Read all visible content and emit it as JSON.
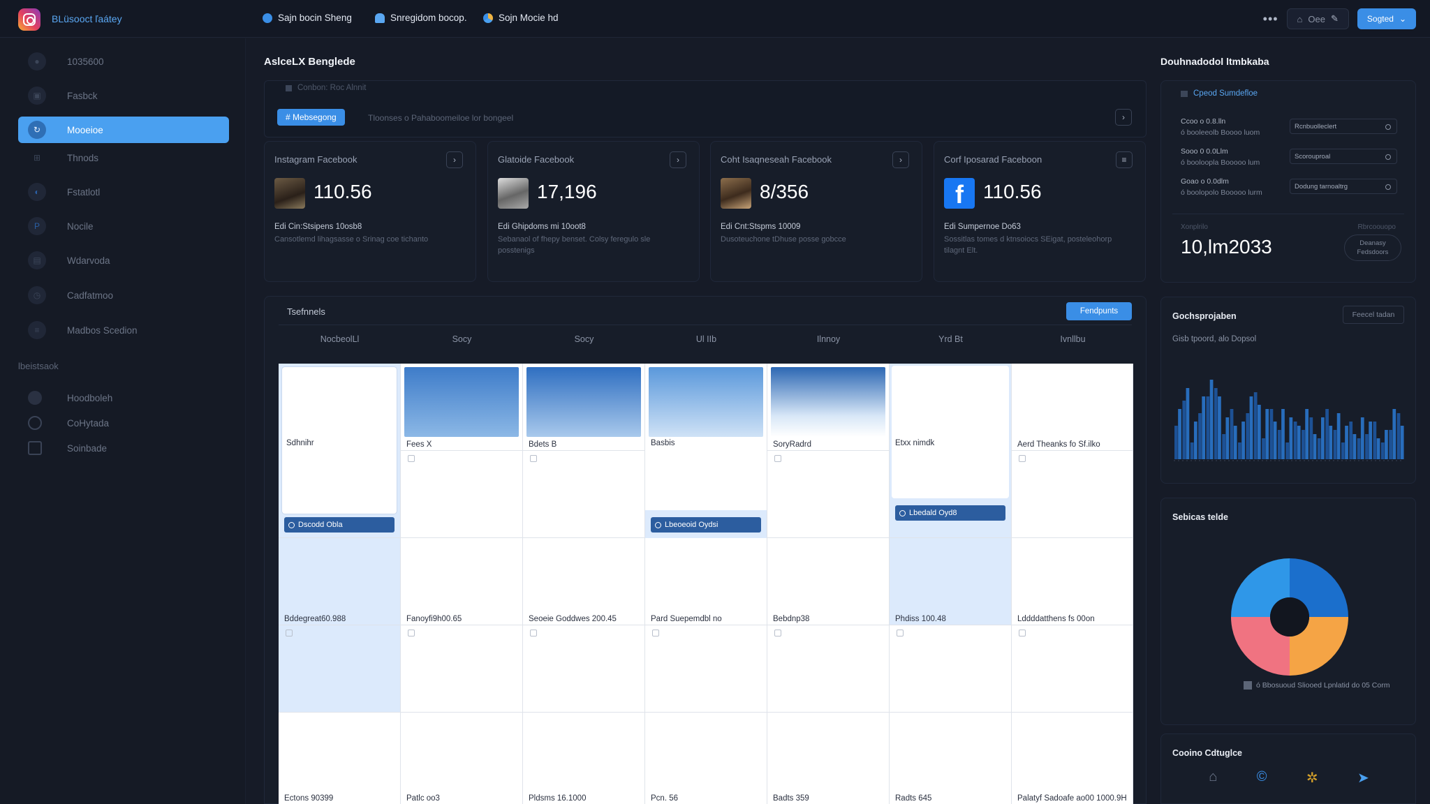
{
  "app": {
    "brand": "BLüsooct ľaátey"
  },
  "topnav": [
    {
      "label": "Sajn bocin Sheng",
      "color": "#3a8ee6"
    },
    {
      "label": "Snregidom bocop.",
      "color": "#5aa7f2"
    },
    {
      "label": "Sojn Mocie hd",
      "color": "#f0b443"
    }
  ],
  "topright": {
    "more": "•••",
    "ghost_label": "Oee",
    "primary_label": "Sogted"
  },
  "sidebar": {
    "items": [
      {
        "label": "1035600",
        "icon": "circle-icon"
      },
      {
        "label": "Fasbck",
        "icon": "image-icon"
      },
      {
        "label": "Mooeioe",
        "icon": "refresh-icon",
        "active": true
      },
      {
        "label": "Thnods",
        "icon": "grid-icon"
      },
      {
        "label": "Fstatlotl",
        "icon": "calendar-icon"
      },
      {
        "label": "Nocile",
        "icon": "page-icon"
      },
      {
        "label": "Wdarvoda",
        "icon": "lock-icon"
      },
      {
        "label": "Cadfatmoo",
        "icon": "clock-icon"
      },
      {
        "label": "Madbos Scedion",
        "icon": "sliders-icon"
      }
    ],
    "section_label": "lbeistsaok",
    "sub_items": [
      {
        "label": "Hoodboleh",
        "icon": "settings-icon"
      },
      {
        "label": "CoHytada",
        "icon": "circle-outline-icon"
      },
      {
        "label": "Soinbade",
        "icon": "calendar-outline-icon"
      }
    ]
  },
  "main": {
    "title": "AslceLX Benglede",
    "filter_hint": "Conbon: Roc Alnnit",
    "chip": "# Mebsegong",
    "filter_text": "Tloonses o Pahaboomeiloe lor bongeel",
    "cards": [
      {
        "title": "Instagram Facebook",
        "value": "110.56",
        "line1": "Edi Cin:Stsipens 10osb8",
        "line2": "Cansotlemd lihagsasse o Srinag coe tichanto",
        "thumb": "photo"
      },
      {
        "title": "Glatoide Facebook",
        "value": "17,196",
        "line1": "Edi Ghipdoms mi 10oot8",
        "line2": "Sebanaol of fhepy benset. Colsy feregulo sle posstenigs",
        "thumb": "photo"
      },
      {
        "title": "Coht Isaqneseah Facebook",
        "value": "8/356",
        "line1": "Edi Cnt:Stspms 10009",
        "line2": "Dusoteuchone tDhuse posse gobcce",
        "thumb": "photo"
      },
      {
        "title": "Corf Iposarad Faceboon",
        "value": "110.56",
        "line1": "Edi Sumpernoe Do63",
        "line2": "Sossitlas tomes d ktnsoiocs SEigat, posteleohorp tilagnt Elt.",
        "thumb": "facebook"
      }
    ]
  },
  "calendar": {
    "title": "Tsefnnels",
    "button": "Fendpunts",
    "days": [
      "NocbeolLl",
      "Socy",
      "Socy",
      "Ul IIb",
      "Ilnnoy",
      "Yrd Bt",
      "Ivnllbu"
    ],
    "rows": [
      [
        "Sdhnihr",
        "Fees X",
        "Bdets B",
        "Basbis",
        "SoryRadrd",
        "Etxx nimdk",
        "Aerd Theanks fo Sf.ilko"
      ],
      [
        "Bddegreat60.988",
        "Fanoyfi9h00.65",
        "Seoeie Goddwes 200.45",
        "Pard Suepemdbl no",
        "Bebdnp38",
        "Phdiss 100.48",
        "Lddddatthens fs 00on"
      ],
      [
        "Ectons 90399",
        "Patlc oo3",
        "Pldsms 16.1000",
        "Pcn. 56",
        "Badts 359",
        "Radts 645",
        "Palatyf Sadoafe ao00 1000.9H"
      ]
    ],
    "events": [
      "Dscodd Obla",
      "Lbeoeoid Oydsi",
      "Lbedald Oyd8"
    ]
  },
  "right": {
    "title": "Douhnadodol ltmbkaba",
    "panel_head": "Cpeod Sumdefloe",
    "rows": [
      {
        "a": "Ccoo o 0.8.lln",
        "b": "ó booleeolb Boooo luom",
        "select": "Rcnbuolleclert"
      },
      {
        "a": "Sooo 0 0.0Llm",
        "b": "ó booloopla Booooo lum",
        "select": "Scorouproal"
      },
      {
        "a": "Goao o 0.0dlm",
        "b": "ó boolopolo Booooo lurm",
        "select": "Dodung tarnoaltrg"
      }
    ],
    "left_small": "Xonplrilo",
    "right_small": "Rbrcoouopo",
    "big_value": "10,lm2033",
    "pill": "Deanasy Fedsdoors",
    "chart_card": {
      "title": "Gochsprojaben",
      "button": "Feecel tadan",
      "subtitle": "Gisb tpoord, alo Dopsol"
    },
    "pie_card": {
      "title": "Sebicas telde",
      "legend": "ó Bbosuoud Sliooed Lpnlatid do 05 Corm"
    },
    "icons_card": {
      "title": "Cooino Cdtuglce"
    }
  },
  "chart_data": [
    {
      "type": "bar",
      "title": "Gochsprojaben",
      "subtitle": "Gisb tpoord, alo Dopsol",
      "series": [
        {
          "values": [
            40,
            70,
            20,
            55,
            75,
            85,
            30,
            60,
            20,
            55,
            80,
            25,
            60,
            35,
            20,
            45,
            35,
            50,
            25,
            60,
            35,
            20,
            45,
            25,
            30,
            45,
            20,
            35,
            55
          ]
        },
        {
          "values": [
            60,
            85,
            45,
            75,
            95,
            75,
            50,
            40,
            45,
            75,
            65,
            60,
            45,
            60,
            50,
            40,
            60,
            30,
            50,
            40,
            55,
            40,
            30,
            50,
            45,
            25,
            35,
            60,
            40
          ]
        }
      ],
      "colors": [
        "#1f5aa8",
        "#2c7bd6"
      ]
    },
    {
      "type": "pie",
      "title": "Sebicas telde",
      "values": [
        25,
        25,
        25,
        25
      ],
      "colors": [
        "#1b6fcc",
        "#f5a445",
        "#f07381",
        "#2f97e8"
      ]
    }
  ]
}
